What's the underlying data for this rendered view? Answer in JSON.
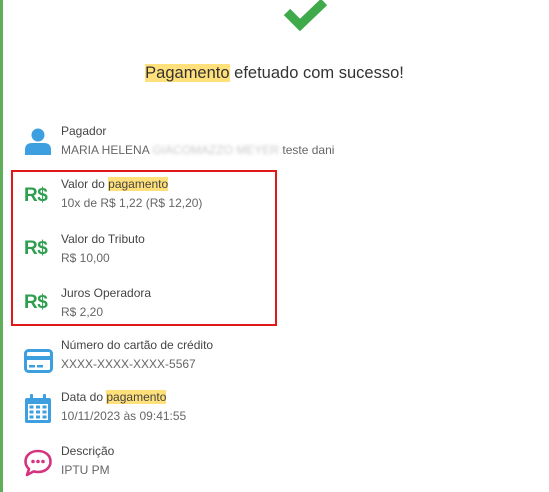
{
  "colors": {
    "success_green": "#3faa4a",
    "icon_blue": "#3d9fe0",
    "highlight": "#ffe07a",
    "box_red": "#e11818"
  },
  "icons": {
    "status": "check-icon",
    "payer": "user-icon",
    "currency": "real-currency-icon",
    "card": "credit-card-icon",
    "date": "calendar-icon",
    "description": "chat-bubble-icon"
  },
  "title": {
    "highlight": "Pagamento",
    "rest": " efetuado com sucesso!"
  },
  "payer": {
    "label": "Pagador",
    "name_start": "MARIA HELENA ",
    "name_blurred": "GIACOMAZZO MEYER",
    "name_end": " teste dani"
  },
  "currency_symbol": "R$",
  "payment": {
    "label_start": "Valor do ",
    "label_highlight": "pagamento",
    "value": "10x de R$ 1,22 (R$ 12,20)"
  },
  "tribute": {
    "label": "Valor do Tributo",
    "value": "R$ 10,00"
  },
  "interest": {
    "label": "Juros Operadora",
    "value": "R$ 2,20"
  },
  "card": {
    "label": "Número do cartão de crédito",
    "value": "XXXX-XXXX-XXXX-5567"
  },
  "date": {
    "label_start": "Data do ",
    "label_highlight": "pagamento",
    "value": "10/11/2023 às 09:41:55"
  },
  "description": {
    "label": "Descrição",
    "value": "IPTU PM"
  }
}
